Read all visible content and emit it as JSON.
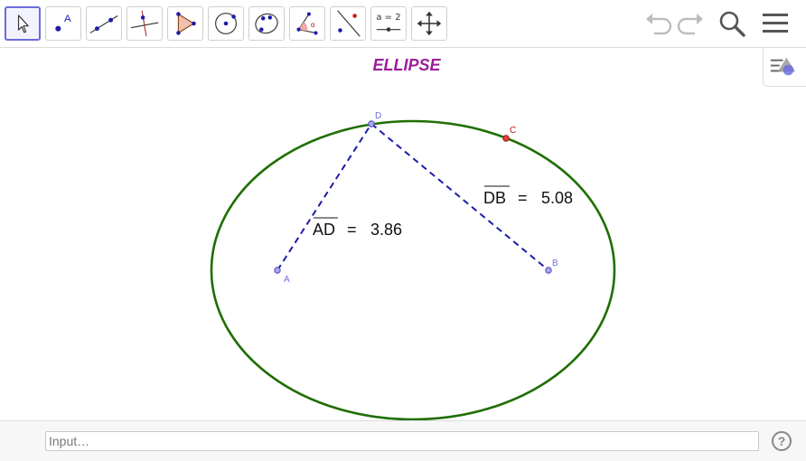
{
  "title": "ELLIPSE",
  "colors": {
    "title": "#9b1e9b",
    "ellipse": "#1e6e00",
    "segment": "#1c1ca8",
    "point_blue": "#6f6fe0",
    "point_red": "#c81414",
    "selected_border": "#6b6bdc"
  },
  "toolbar": {
    "tools": [
      {
        "name": "move-tool",
        "icon": "arrow-cursor-icon"
      },
      {
        "name": "point-tool",
        "icon": "point-icon",
        "label": "A"
      },
      {
        "name": "line-tool",
        "icon": "line-icon"
      },
      {
        "name": "perpendicular-tool",
        "icon": "perpendicular-line-icon"
      },
      {
        "name": "polygon-tool",
        "icon": "polygon-icon"
      },
      {
        "name": "circle-tool",
        "icon": "circle-center-icon"
      },
      {
        "name": "conic-tool",
        "icon": "ellipse-icon"
      },
      {
        "name": "angle-tool",
        "icon": "angle-icon",
        "label": "α"
      },
      {
        "name": "reflect-tool",
        "icon": "reflect-icon"
      },
      {
        "name": "slider-tool",
        "icon": "slider-icon",
        "label": "a = 2"
      },
      {
        "name": "move-view-tool",
        "icon": "move-graphics-icon"
      }
    ],
    "right": [
      {
        "name": "undo",
        "icon": "undo-icon"
      },
      {
        "name": "redo",
        "icon": "redo-icon"
      },
      {
        "name": "search",
        "icon": "search-icon"
      },
      {
        "name": "menu",
        "icon": "hamburger-menu-icon"
      }
    ]
  },
  "points": {
    "A": "A",
    "B": "B",
    "C": "C",
    "D": "D"
  },
  "measurements": {
    "ad": {
      "segment": "AD",
      "equals": "=",
      "value": "3.86"
    },
    "db": {
      "segment": "DB",
      "equals": "=",
      "value": "5.08"
    }
  },
  "input_bar": {
    "placeholder": "Input…",
    "help_label": "?"
  }
}
